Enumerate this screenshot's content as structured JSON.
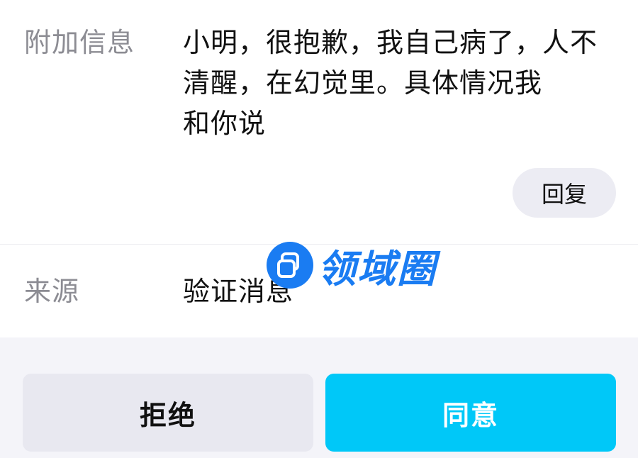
{
  "extra_info": {
    "label": "附加信息",
    "text_lines": [
      "小明，很抱歉，我自己病了，人不",
      "清醒，在幻觉里。具体情况我",
      "和你说"
    ],
    "reply_label": "回复"
  },
  "source": {
    "label": "来源",
    "value": "验证消息"
  },
  "actions": {
    "reject_label": "拒绝",
    "accept_label": "同意"
  },
  "watermark": {
    "text": "领域圈",
    "icon": "overlapping-squares-icon"
  },
  "colors": {
    "accent": "#00c8f8",
    "label_gray": "#8c8c93",
    "watermark_blue": "#1a7cf2",
    "button_gray": "#e8e8f0",
    "bar_background": "#f4f4f9"
  }
}
